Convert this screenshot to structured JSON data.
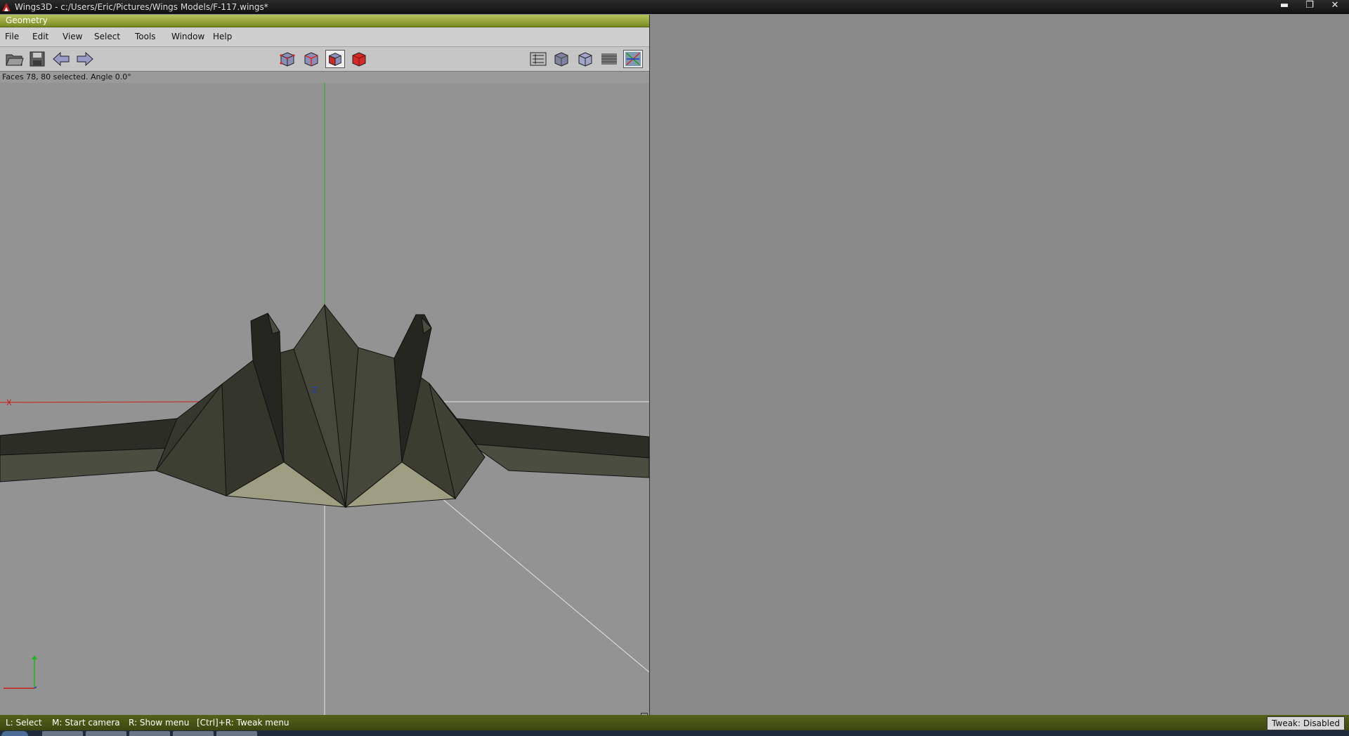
{
  "app": {
    "window_title": "Wings3D - c:/Users/Eric/Pictures/Wings Models/F-117.wings*",
    "minimize_label": "▬",
    "maximize_label": "❐",
    "close_label": "✕"
  },
  "geometry_window": {
    "title": "Geometry",
    "menu": [
      "File",
      "Edit",
      "View",
      "Select",
      "Tools",
      "Window",
      "Help"
    ],
    "toolbar_left": [
      "open-file-icon",
      "save-file-icon",
      "undo-arrow-icon",
      "redo-arrow-icon"
    ],
    "selection_modes": [
      "vertex-mode-icon",
      "edge-mode-icon",
      "face-mode-icon",
      "object-mode-icon"
    ],
    "selected_mode": "face-mode-icon",
    "toolbar_right": [
      "wireframe-toggle-icon",
      "smooth-shade-icon",
      "flat-shade-icon",
      "groundplane-icon",
      "axes-toggle-icon"
    ],
    "info_text": "Faces 78, 80 selected. Angle 0.0°",
    "axis_labels": {
      "x": "X",
      "z": "Z"
    }
  },
  "statusbar": {
    "hints": [
      "L: Select",
      "M: Start camera",
      "R: Show menu",
      "[Ctrl]+R: Tweak menu"
    ],
    "tweak": "Tweak: Disabled"
  },
  "colors": {
    "title_gradient_top": "#b6c45c",
    "status_bar": "#4a5615",
    "model_dark": "#34362b",
    "model_mid": "#45463a",
    "selected_face": "#9e9f82",
    "axis_x": "#cc1a1a",
    "axis_y": "#18b818",
    "axis_z": "#1a3acc"
  }
}
